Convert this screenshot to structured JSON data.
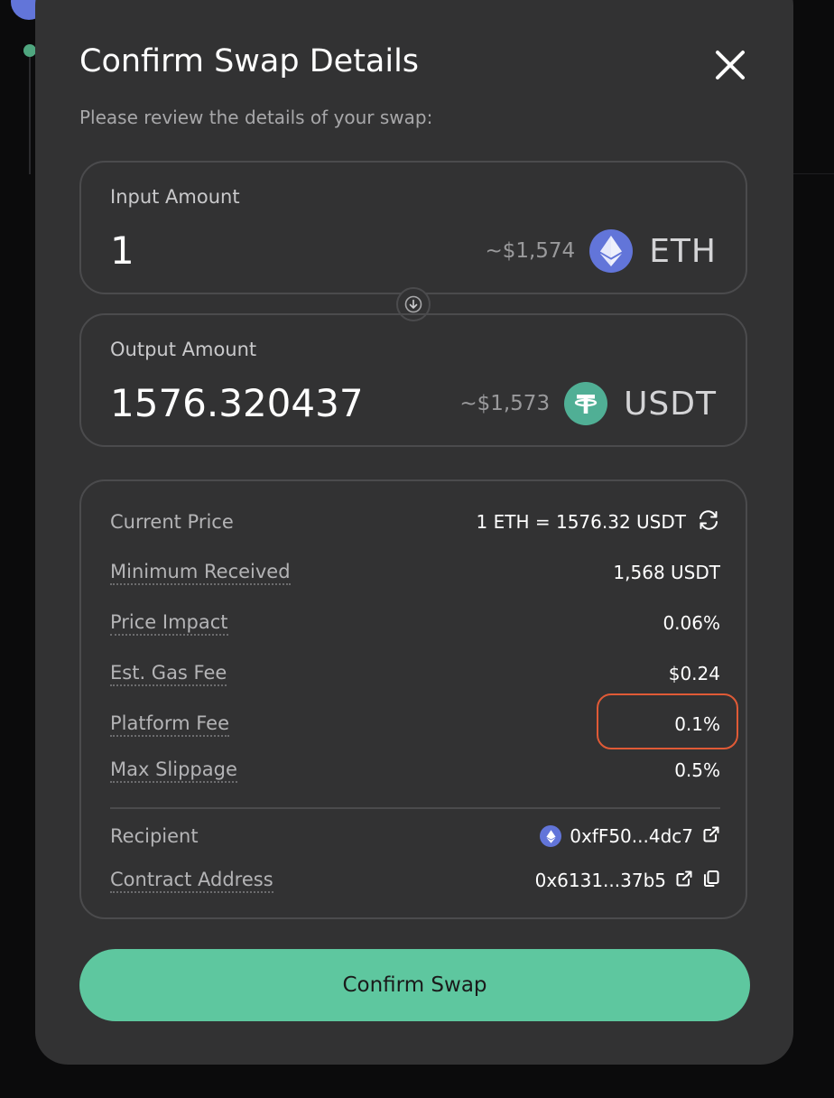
{
  "modal": {
    "title": "Confirm Swap Details",
    "subtitle": "Please review the details of your swap:"
  },
  "input": {
    "label": "Input Amount",
    "amount": "1",
    "usd": "~$1,574",
    "token": "ETH",
    "token_icon": "ethereum-icon",
    "token_color": "#6275d9"
  },
  "output": {
    "label": "Output Amount",
    "amount": "1576.320437",
    "usd": "~$1,573",
    "token": "USDT",
    "token_icon": "tether-icon",
    "token_color": "#50af95"
  },
  "details": {
    "current_price": {
      "label": "Current Price",
      "value": "1 ETH = 1576.32 USDT"
    },
    "minimum_received": {
      "label": "Minimum Received",
      "value": "1,568 USDT"
    },
    "price_impact": {
      "label": "Price Impact",
      "value": "0.06%"
    },
    "gas_fee": {
      "label": "Est. Gas Fee",
      "value": "$0.24"
    },
    "platform_fee": {
      "label": "Platform Fee",
      "value": "0.1%"
    },
    "max_slippage": {
      "label": "Max Slippage",
      "value": "0.5%"
    },
    "recipient": {
      "label": "Recipient",
      "value": "0xfF50...4dc7"
    },
    "contract_address": {
      "label": "Contract Address",
      "value": "0x6131...37b5"
    }
  },
  "confirm_button": "Confirm Swap",
  "colors": {
    "accent": "#5ec79f",
    "highlight": "#e05a36",
    "modal_bg": "#323233"
  }
}
